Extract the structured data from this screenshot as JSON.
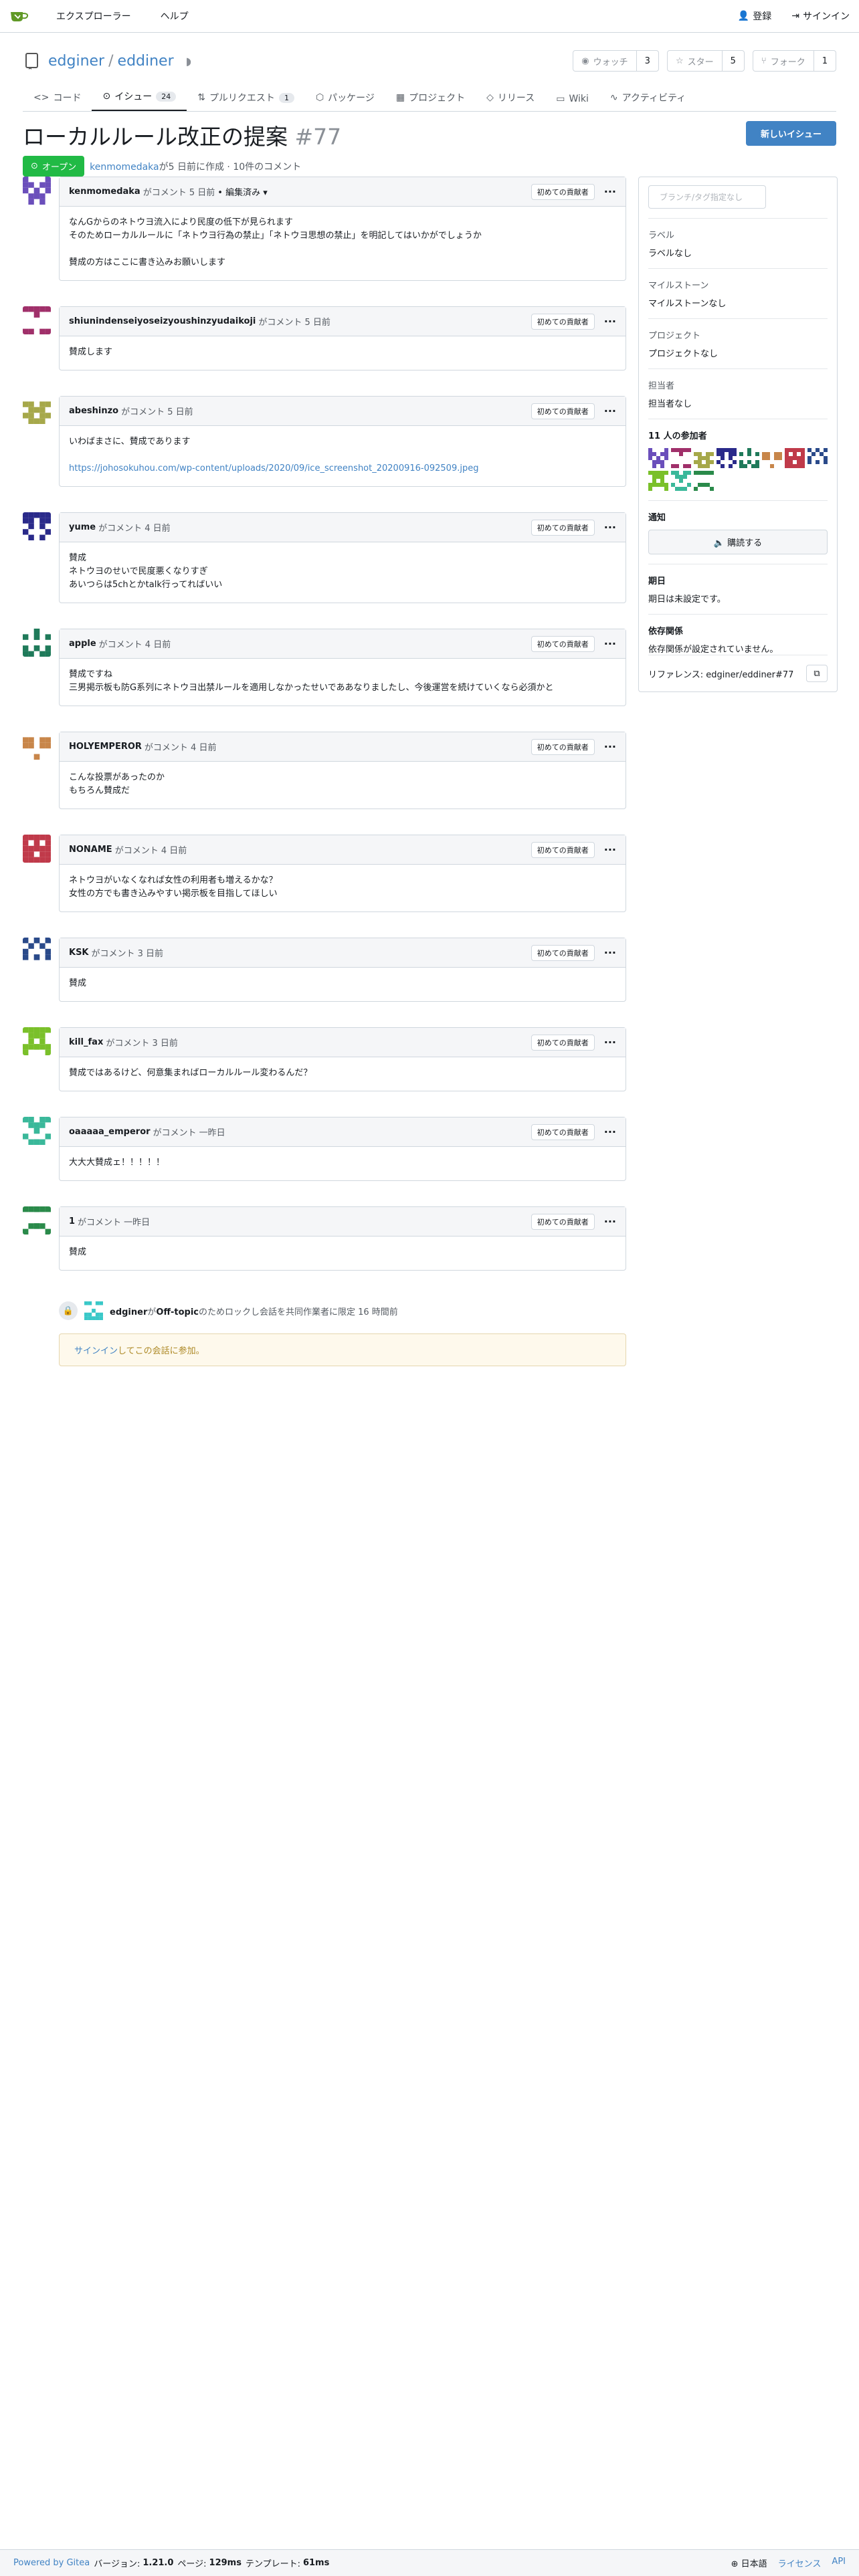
{
  "nav": {
    "explore": "エクスプローラー",
    "help": "ヘルプ",
    "register": "登録",
    "signin": "サインイン"
  },
  "repo": {
    "owner": "edginer",
    "name": "eddiner",
    "watch_label": "ウォッチ",
    "watch_count": "3",
    "star_label": "スター",
    "star_count": "5",
    "fork_label": "フォーク",
    "fork_count": "1"
  },
  "tabs": [
    {
      "label": "コード"
    },
    {
      "label": "イシュー",
      "count": "24"
    },
    {
      "label": "プルリクエスト",
      "count": "1"
    },
    {
      "label": "パッケージ"
    },
    {
      "label": "プロジェクト"
    },
    {
      "label": "リリース"
    },
    {
      "label": "Wiki"
    },
    {
      "label": "アクティビティ"
    }
  ],
  "issue": {
    "title": "ローカルルール改正の提案",
    "number": "#77",
    "state": "オープン",
    "author": "kenmomedaka",
    "meta": "が5 日前に作成 · 10件のコメント",
    "new_issue": "新しいイシュー"
  },
  "first_contributor_label": "初めての貢献者",
  "comments": [
    {
      "user": "kenmomedaka",
      "time": "がコメント 5 日前",
      "edited": "• 編集済み ▾",
      "lines": [
        "なんGからのネトウヨ流入により民度の低下が見られます",
        "そのためローカルルールに「ネトウヨ行為の禁止」「ネトウヨ思想の禁止」を明記してはいかがでしょうか",
        "",
        "賛成の方はここに書き込みお願いします"
      ],
      "color": "#6b4fbb"
    },
    {
      "user": "shiunindenseiyoseizyoushinzyudaikoji",
      "time": "がコメント 5 日前",
      "lines": [
        "賛成します"
      ],
      "color": "#a0306a"
    },
    {
      "user": "abeshinzo",
      "time": "がコメント 5 日前",
      "lines": [
        "いわばまさに、賛成であります",
        "",
        "https://johosokuhou.com/wp-content/uploads/2020/09/ice_screenshot_20200916-092509.jpeg"
      ],
      "color": "#a6a84a"
    },
    {
      "user": "yume",
      "time": "がコメント 4 日前",
      "lines": [
        "賛成",
        "ネトウヨのせいで民度悪くなりすぎ",
        "あいつらは5chとかtalk行ってればいい"
      ],
      "color": "#2a2a8a"
    },
    {
      "user": "apple",
      "time": "がコメント 4 日前",
      "lines": [
        "賛成ですね",
        "三男掲示板も防G系列にネトウヨ出禁ルールを適用しなかったせいでああなりましたし、今後運営を続けていくなら必須かと"
      ],
      "color": "#1f7a5a"
    },
    {
      "user": "HOLYEMPEROR",
      "time": "がコメント 4 日前",
      "lines": [
        "こんな投票があったのか",
        "もちろん賛成だ"
      ],
      "color": "#c8864a"
    },
    {
      "user": "NONAME",
      "time": "がコメント 4 日前",
      "lines": [
        "ネトウヨがいなくなれば女性の利用者も増えるかな？",
        "女性の方でも書き込みやすい掲示板を目指してほしい"
      ],
      "color": "#c03a4a"
    },
    {
      "user": "KSK",
      "time": "がコメント 3 日前",
      "lines": [
        "賛成"
      ],
      "color": "#2a4a8a"
    },
    {
      "user": "kill_fax",
      "time": "がコメント 3 日前",
      "lines": [
        "賛成ではあるけど、何意集まればローカルルール変わるんだ？"
      ],
      "color": "#7ac02a"
    },
    {
      "user": "oaaaaa_emperor",
      "time": "がコメント 一昨日",
      "lines": [
        "大大大賛成ェ！！！！！"
      ],
      "color": "#3ab89a"
    },
    {
      "user": "1",
      "time": "がコメント 一昨日",
      "lines": [
        "賛成"
      ],
      "color": "#2a8a4a"
    }
  ],
  "lock_event": {
    "user": "edginer",
    "text_pre": "が",
    "reason": "Off-topic",
    "text_post": "のためロックし会話を共同作業者に限定 16 時間前"
  },
  "signin_notice": {
    "link": "サインイン",
    "text": "してこの会話に参加。"
  },
  "sidebar": {
    "branch_placeholder": "ブランチ/タグ指定なし",
    "labels_h": "ラベル",
    "labels_v": "ラベルなし",
    "milestone_h": "マイルストーン",
    "milestone_v": "マイルストーンなし",
    "project_h": "プロジェクト",
    "project_v": "プロジェクトなし",
    "assignee_h": "担当者",
    "assignee_v": "担当者なし",
    "participants_h": "11 人の参加者",
    "notify_h": "通知",
    "subscribe": "購読する",
    "due_h": "期日",
    "due_v": "期日は未設定です。",
    "deps_h": "依存関係",
    "deps_v": "依存関係が設定されていません。",
    "reference": "リファレンス: edginer/eddiner#77"
  },
  "footer": {
    "powered": "Powered by Gitea",
    "version_label": "バージョン:",
    "version": "1.21.0",
    "page_label": "ページ:",
    "page_time": "129ms",
    "template_label": "テンプレート:",
    "template_time": "61ms",
    "language": "日本語",
    "license": "ライセンス",
    "api": "API"
  }
}
